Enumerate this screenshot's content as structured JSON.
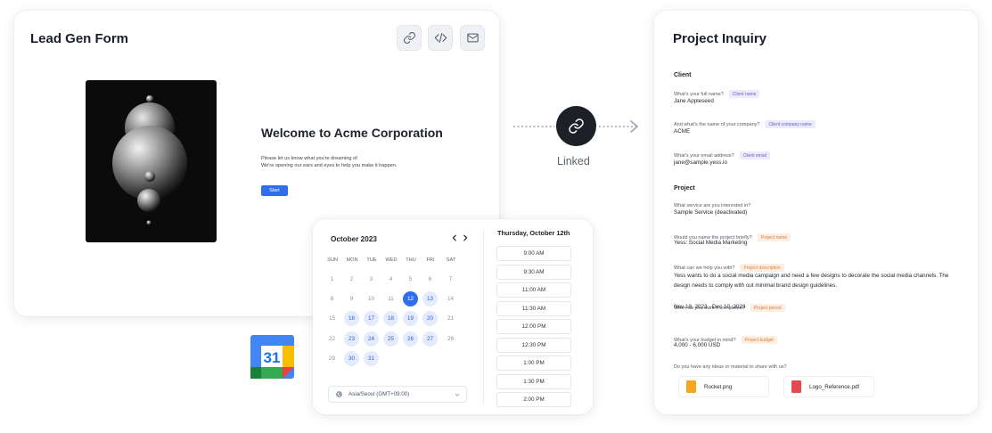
{
  "lead_form": {
    "title": "Lead Gen Form",
    "toolbar_icons": [
      "link-icon",
      "code-icon",
      "mail-icon"
    ],
    "welcome_title": "Welcome to Acme Corporation",
    "description_lines": [
      "Please let us know what you're dreaming of.",
      "We're opening our ears and eyes to help you make it happen."
    ],
    "start_label": "Start"
  },
  "calendar": {
    "month_label": "October 2023",
    "weekdays": [
      "SUN",
      "MON",
      "TUE",
      "WED",
      "THU",
      "FRI",
      "SAT"
    ],
    "weeks": [
      [
        1,
        2,
        3,
        4,
        5,
        6,
        7
      ],
      [
        8,
        9,
        10,
        11,
        12,
        13,
        14
      ],
      [
        15,
        16,
        17,
        18,
        19,
        20,
        21
      ],
      [
        22,
        23,
        24,
        25,
        26,
        27,
        28
      ],
      [
        29,
        30,
        31
      ]
    ],
    "available_days": [
      13,
      16,
      17,
      18,
      19,
      20,
      23,
      24,
      25,
      26,
      27,
      30,
      31
    ],
    "selected_day": 12,
    "timezone": "Asia/Seoul (GMT+09:00)",
    "selected_date_label": "Thursday, October 12th",
    "time_slots": [
      "9:00 AM",
      "9:30 AM",
      "11:00 AM",
      "11:30 AM",
      "12:00 PM",
      "12:30 PM",
      "1:00 PM",
      "1:30 PM",
      "2:00 PM"
    ]
  },
  "google_calendar": {
    "day_number": "31",
    "colors": {
      "blue": "#4285F4",
      "red": "#EA4335",
      "yellow": "#FBBC04",
      "green": "#34A853"
    }
  },
  "connector": {
    "label": "Linked",
    "icon": "link-icon"
  },
  "project_inquiry": {
    "title": "Project Inquiry",
    "sections": {
      "client": "Client",
      "project": "Project"
    },
    "fields": [
      {
        "question": "What's your full name?",
        "tag": "Client name",
        "tag_color": "purple",
        "answer": "Jane Appleseed"
      },
      {
        "question": "And what's the name of your company?",
        "tag": "Client company name",
        "tag_color": "purple",
        "answer": "ACME"
      },
      {
        "question": "What's your email address?",
        "tag": "Client email",
        "tag_color": "purple",
        "answer": "jane@sample.yess.io"
      },
      {
        "question": "What service are you interested in?",
        "tag": "",
        "tag_color": "",
        "answer": "Sample Service (deactivated)"
      },
      {
        "question": "Would you name the project briefly?",
        "tag": "Project name",
        "tag_color": "orange",
        "answer": "Yess: Social Media Marketing"
      },
      {
        "question": "What can we help you with?",
        "tag": "Project description",
        "tag_color": "orange",
        "answer": "Yess wants to do a social media campaign and need a few designs to decorate the social media channels. The design needs to comply with out minimal brand design guidelines."
      },
      {
        "question": "When do you want it completed?",
        "tag": "Project period",
        "tag_color": "orange",
        "answer": "Nov 10, 2023 - Dec 10, 2023"
      },
      {
        "question": "What's your budget in mind?",
        "tag": "Project budget",
        "tag_color": "orange",
        "answer": "4,000 - 6,000 USD"
      },
      {
        "question": "Do you have any ideas or material to share with us?",
        "tag": "",
        "tag_color": "",
        "answer": ""
      }
    ],
    "attachments": [
      {
        "name": "Rocket.png",
        "icon": "image-file-icon",
        "color": "#F5A524"
      },
      {
        "name": "Logo_Reference.pdf",
        "icon": "pdf-file-icon",
        "color": "#E5484D"
      }
    ]
  }
}
